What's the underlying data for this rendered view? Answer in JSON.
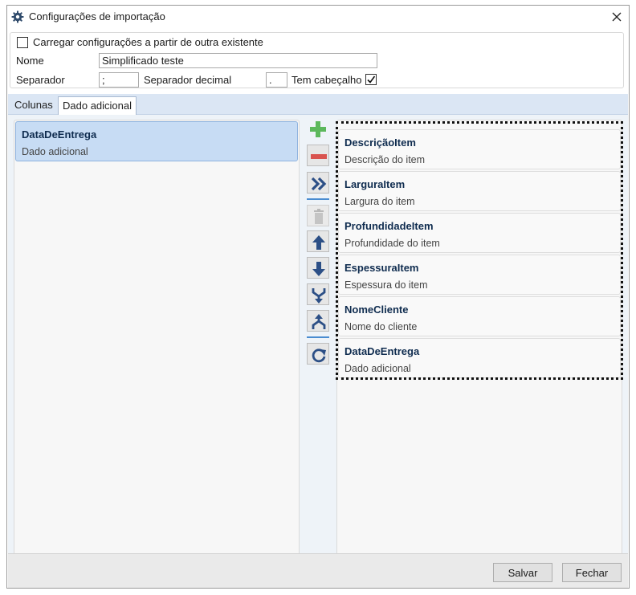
{
  "window": {
    "title": "Configurações de importação",
    "icon": "gear-icon",
    "close_icon": "close-icon"
  },
  "settings": {
    "load_existing_label": "Carregar configurações a partir de outra existente",
    "load_existing_checked": false,
    "name_label": "Nome",
    "name_value": "Simplificado teste",
    "separator_label": "Separador",
    "separator_value": ";",
    "decimal_separator_label": "Separador decimal",
    "decimal_separator_value": ".",
    "has_header_label": "Tem cabeçalho",
    "has_header_checked": true
  },
  "tabs": [
    {
      "label": "Colunas",
      "active": false
    },
    {
      "label": "Dado adicional",
      "active": true
    }
  ],
  "selected_items": [
    {
      "name": "DataDeEntrega",
      "description": "Dado adicional",
      "selected": true
    }
  ],
  "available_items": [
    {
      "name": "DescriçãoItem",
      "description": "Descrição do item"
    },
    {
      "name": "LarguraItem",
      "description": "Largura do item"
    },
    {
      "name": "ProfundidadeItem",
      "description": "Profundidade do item"
    },
    {
      "name": "EspessuraItem",
      "description": "Espessura do item"
    },
    {
      "name": "NomeCliente",
      "description": "Nome do cliente"
    },
    {
      "name": "DataDeEntrega",
      "description": "Dado adicional"
    }
  ],
  "toolbar": [
    "plus-icon",
    "minus-icon",
    "move-all-right-icon",
    "trash-icon",
    "arrow-up-icon",
    "arrow-down-icon",
    "merge-icon",
    "split-icon",
    "refresh-icon"
  ],
  "colors": {
    "accent": "#4a8cd0",
    "selected_item": "#c7dcf4",
    "add_green": "#5cb85c",
    "remove_red": "#d9534f"
  },
  "footer": {
    "save_label": "Salvar",
    "close_label": "Fechar"
  }
}
